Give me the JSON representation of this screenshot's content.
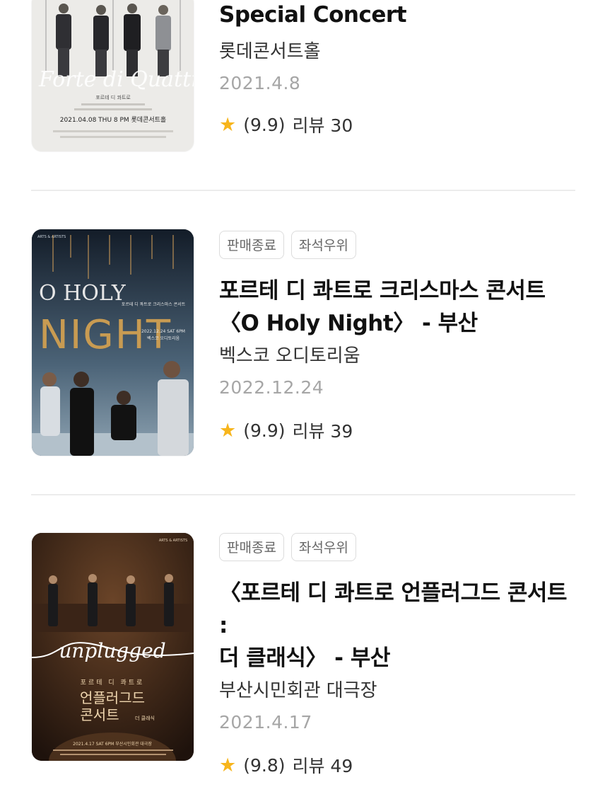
{
  "items": [
    {
      "title_lines": [
        "Special Concert"
      ],
      "venue": "롯데콘서트홀",
      "date": "2021.4.8",
      "rating": "(9.9)",
      "reviews": "리뷰 30",
      "poster": {
        "script_text": "Forte di Quattro",
        "small_text": "포르테 디 콰트로",
        "date_text": "2021.04.08 THU 8 PM  롯데콘서트홀"
      }
    },
    {
      "tags": [
        "판매종료",
        "좌석우위"
      ],
      "title_lines": [
        "포르테 디 콰트로 크리스마스 콘서트",
        "〈O Holy Night〉 - 부산"
      ],
      "venue": "벡스코 오디토리움",
      "date": "2022.12.24",
      "rating": "(9.9)",
      "reviews": "리뷰 39",
      "poster": {
        "brand": "ARTS & ARTISTS",
        "line1": "O HOLY",
        "line2": "NIGHT",
        "subtitle": "포르테 디 콰트로 크리스마스 콘서트",
        "date_text": "2022.12.24 SAT 6PM",
        "venue_text": "벡스코 오디토리움"
      }
    },
    {
      "tags": [
        "판매종료",
        "좌석우위"
      ],
      "title_lines": [
        "〈포르테 디 콰트로 언플러그드 콘서트 :",
        "더 클래식〉 - 부산"
      ],
      "venue": "부산시민회관 대극장",
      "date": "2021.4.17",
      "rating": "(9.8)",
      "reviews": "리뷰 49",
      "poster": {
        "brand": "ARTS & ARTISTS",
        "script_text": "unplugged",
        "group_text": "포르테 디 콰트로",
        "title_line1": "언플러그드",
        "title_line2": "콘서트",
        "sub_text": "더 클래식",
        "date_text": "2021.4.17 SAT 6PM  부산시민회관 대극장"
      }
    }
  ],
  "colors": {
    "star": "#f7b51c",
    "date": "#a6a6a6",
    "tag_border": "#dcdcdc",
    "divider": "#ececec"
  }
}
